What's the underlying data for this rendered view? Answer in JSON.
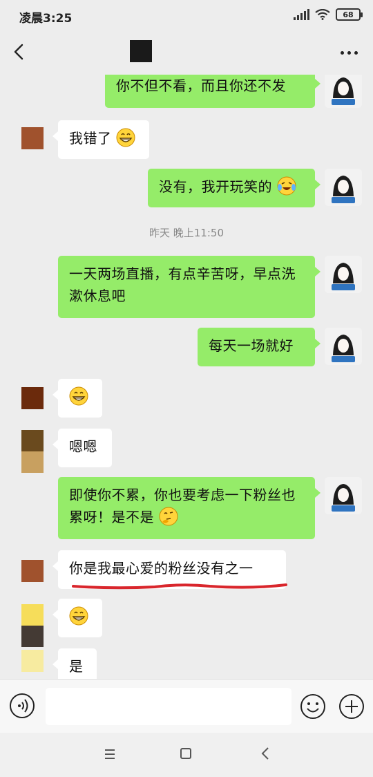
{
  "status_bar": {
    "time": "凌晨3:25",
    "battery": "68",
    "icons": [
      "signal-icon",
      "wifi-icon",
      "battery-icon"
    ]
  },
  "header": {
    "back_icon": "chevron-left-icon",
    "more_icon": "more-dots-icon"
  },
  "messages": [
    {
      "side": "right",
      "text": "你不但不看，而且你还不发"
    },
    {
      "side": "left",
      "text": "我错了",
      "emoji": "grin-emoji"
    },
    {
      "side": "right",
      "text": "没有，我开玩笑的",
      "emoji": "crying-laughing-emoji"
    },
    {
      "side": "right",
      "text": "一天两场直播，有点辛苦呀，早点洗漱休息吧"
    },
    {
      "side": "right",
      "text": "每天一场就好"
    },
    {
      "side": "left",
      "text": "",
      "emoji": "grin-emoji"
    },
    {
      "side": "left",
      "text": "嗯嗯"
    },
    {
      "side": "right",
      "text": "即使你不累，你也要考虑一下粉丝也累呀！是不是",
      "emoji": "thinking-emoji"
    },
    {
      "side": "left",
      "text": "你是我最心爱的粉丝没有之一"
    },
    {
      "side": "left",
      "text": "",
      "emoji": "grin-emoji"
    },
    {
      "side": "left",
      "text": "是"
    }
  ],
  "timestamp": "昨天 晚上11:50",
  "input_bar": {
    "voice_icon": "voice-icon",
    "emoji_icon": "smiley-icon",
    "plus_icon": "plus-icon"
  },
  "colors": {
    "sent_bubble": "#95ec69",
    "received_bubble": "#ffffff",
    "background": "#ededed",
    "underline": "#d9262c"
  }
}
